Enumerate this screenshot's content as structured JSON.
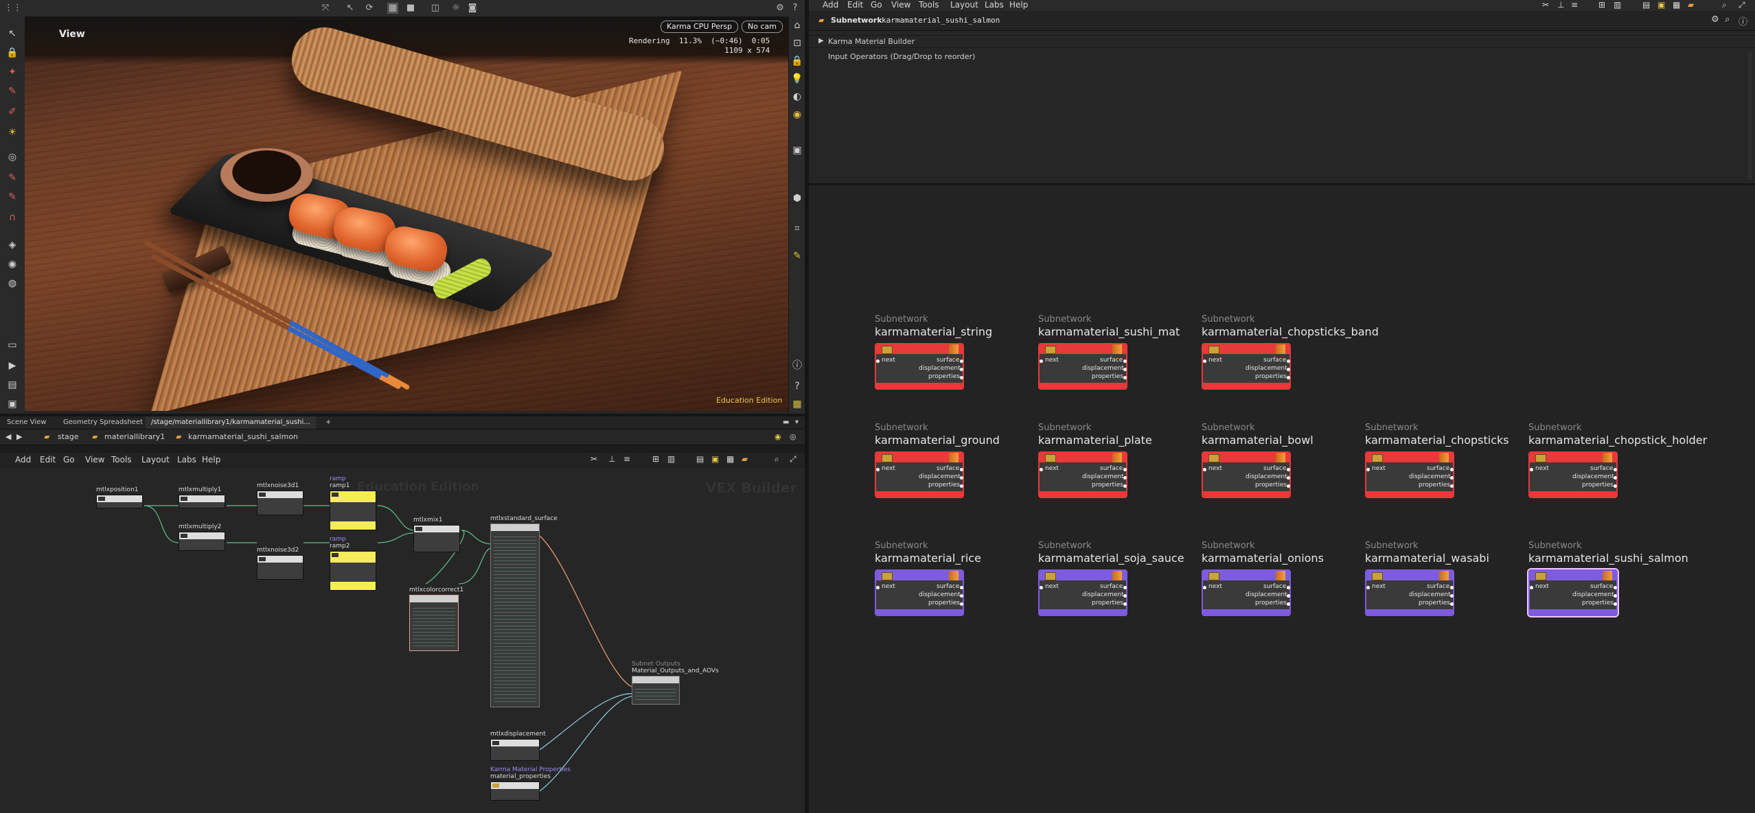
{
  "viewport": {
    "title": "View",
    "renderer_combo": "Karma CPU Persp",
    "camera_combo": "No cam",
    "render_status_line": "Rendering  11.3%  (~0:46)  0:05",
    "render_resolution": "1109 x 574",
    "edition": "Education Edition"
  },
  "pane_tabs": [
    {
      "label": "Scene View"
    },
    {
      "label": "Geometry Spreadsheet"
    },
    {
      "label": "/stage/materiallibrary1/karmamaterial_sushi..."
    }
  ],
  "left_path": [
    "stage",
    "materiallibrary1",
    "karmamaterial_sushi_salmon"
  ],
  "left_menu": [
    "Add",
    "Edit",
    "Go",
    "View",
    "Tools",
    "Layout",
    "Labs",
    "Help"
  ],
  "left_network": {
    "watermark_left": "Education Edition",
    "watermark_right": "VEX Builder",
    "nodes": {
      "mtlxposition1": "mtlxposition1",
      "mtlxmultiply1": "mtlxmultiply1",
      "mtlxmultiply2": "mtlxmultiply2",
      "mtlxnoise3d1": "mtlxnoise3d1",
      "mtlxnoise3d2": "mtlxnoise3d2",
      "ramp1_type": "ramp",
      "ramp1": "ramp1",
      "ramp2_type": "ramp",
      "ramp2": "ramp2",
      "mtlxmix1": "mtlxmix1",
      "mtlxcolorcorrect1": "mtlxcolorcorrect1",
      "mtlxstandard_surface": "mtlxstandard_surface",
      "outputs_type": "Subnet Outputs",
      "outputs": "Material_Outputs_and_AOVs",
      "mtlxdisplacement": "mtlxdisplacement",
      "props_type": "Karma Material Properties",
      "props": "material_properties"
    }
  },
  "right_menu": [
    "Add",
    "Edit",
    "Go",
    "View",
    "Tools",
    "Layout",
    "Labs",
    "Help"
  ],
  "right_header": {
    "type": "Subnetwork",
    "name": "karmamaterial_sushi_salmon"
  },
  "params": {
    "folder": "Karma Material Builder",
    "input_operators": "Input Operators (Drag/Drop to reorder)"
  },
  "port_labels": {
    "next": "next",
    "surface": "surface",
    "displacement": "displacement",
    "properties": "properties"
  },
  "colors": {
    "red_node": "#e8393b",
    "purple_node": "#7d5ce0",
    "accent_yellow": "#e8c84a"
  },
  "materials": [
    {
      "type": "Subnetwork",
      "name": "karmamaterial_string",
      "color": "red"
    },
    {
      "type": "Subnetwork",
      "name": "karmamaterial_sushi_mat",
      "color": "red"
    },
    {
      "type": "Subnetwork",
      "name": "karmamaterial_chopsticks_band",
      "color": "red"
    },
    {
      "type": "Subnetwork",
      "name": "karmamaterial_ground",
      "color": "red"
    },
    {
      "type": "Subnetwork",
      "name": "karmamaterial_plate",
      "color": "red"
    },
    {
      "type": "Subnetwork",
      "name": "karmamaterial_bowl",
      "color": "red"
    },
    {
      "type": "Subnetwork",
      "name": "karmamaterial_chopsticks",
      "color": "red"
    },
    {
      "type": "Subnetwork",
      "name": "karmamaterial_chopstick_holder",
      "color": "red"
    },
    {
      "type": "Subnetwork",
      "name": "karmamaterial_rice",
      "color": "purple"
    },
    {
      "type": "Subnetwork",
      "name": "karmamaterial_soja_sauce",
      "color": "purple"
    },
    {
      "type": "Subnetwork",
      "name": "karmamaterial_onions",
      "color": "purple"
    },
    {
      "type": "Subnetwork",
      "name": "karmamaterial_wasabi",
      "color": "purple"
    },
    {
      "type": "Subnetwork",
      "name": "karmamaterial_sushi_salmon",
      "color": "purple",
      "selected": true
    }
  ]
}
